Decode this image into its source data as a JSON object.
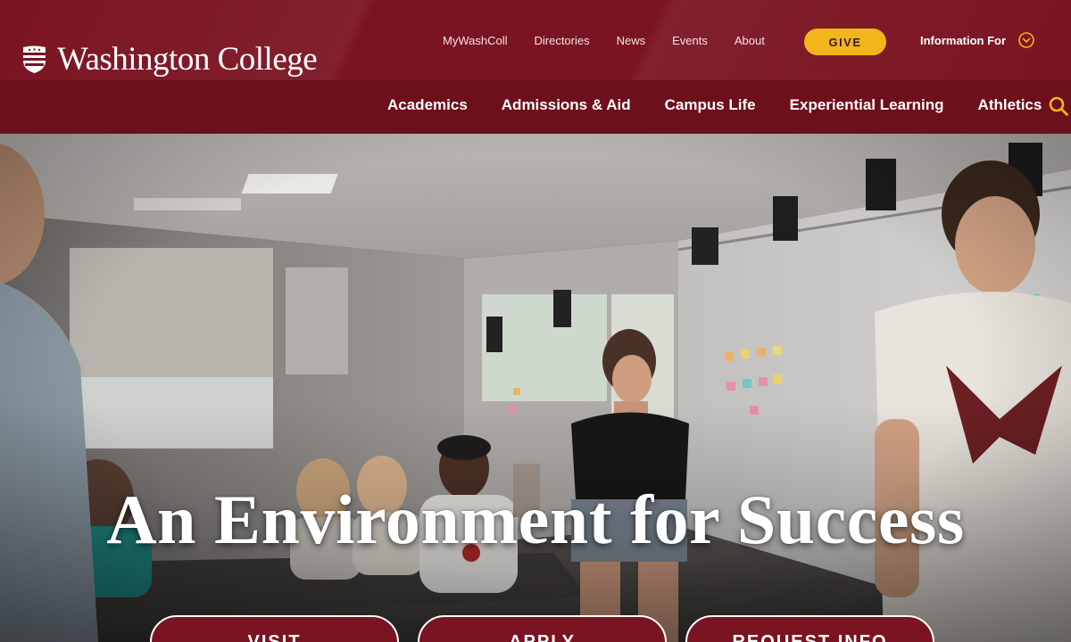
{
  "site": {
    "name": "Washington College"
  },
  "utility_nav": {
    "links": [
      "MyWashColl",
      "Directories",
      "News",
      "Events",
      "About"
    ],
    "give_label": "GIVE",
    "info_for_label": "Information For"
  },
  "main_nav": {
    "items": [
      "Academics",
      "Admissions & Aid",
      "Campus Life",
      "Experiential Learning",
      "Athletics"
    ]
  },
  "hero": {
    "title": "An Environment for Success",
    "ctas": [
      "VISIT",
      "APPLY",
      "REQUEST INFO"
    ]
  },
  "icons": {
    "logo": "shield-icon",
    "info_for": "chevron-down-circle-icon",
    "search": "search-icon"
  },
  "colors": {
    "brand_maroon": "#7b1422",
    "nav_maroon": "#6e0f1c",
    "give_gold": "#f2b51c"
  }
}
